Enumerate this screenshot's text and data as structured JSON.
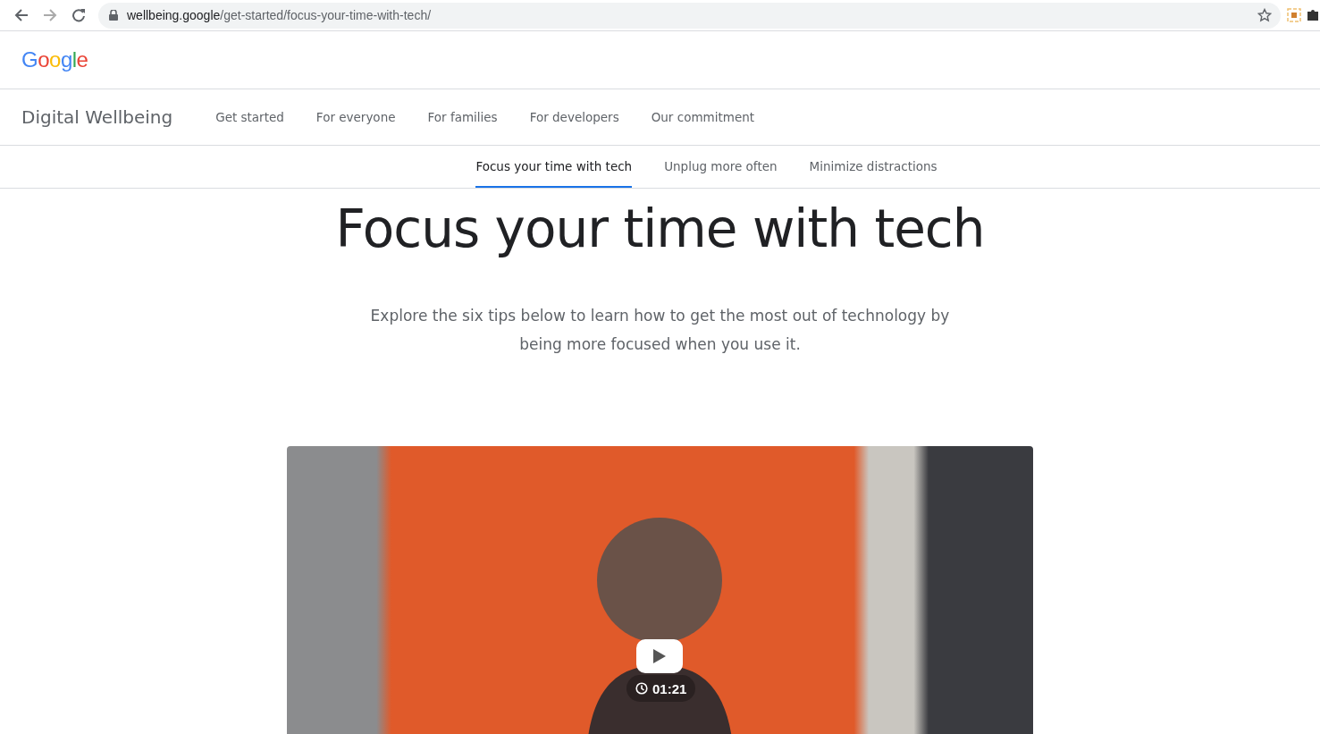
{
  "browser": {
    "url_host": "wellbeing.google",
    "url_path": "/get-started/focus-your-time-with-tech/"
  },
  "header": {
    "logo": "Google"
  },
  "nav": {
    "brand": "Digital Wellbeing",
    "links": [
      {
        "label": "Get started"
      },
      {
        "label": "For everyone"
      },
      {
        "label": "For families"
      },
      {
        "label": "For developers"
      },
      {
        "label": "Our commitment"
      }
    ]
  },
  "subnav": {
    "tabs": [
      {
        "label": "Focus your time with tech",
        "selected": true
      },
      {
        "label": "Unplug more often",
        "selected": false
      },
      {
        "label": "Minimize distractions",
        "selected": false
      }
    ]
  },
  "hero": {
    "title": "Focus your time with tech",
    "intro": "Explore the six tips below to learn how to get the most out of technology by being more focused when you use it."
  },
  "video": {
    "duration": "01:21"
  }
}
